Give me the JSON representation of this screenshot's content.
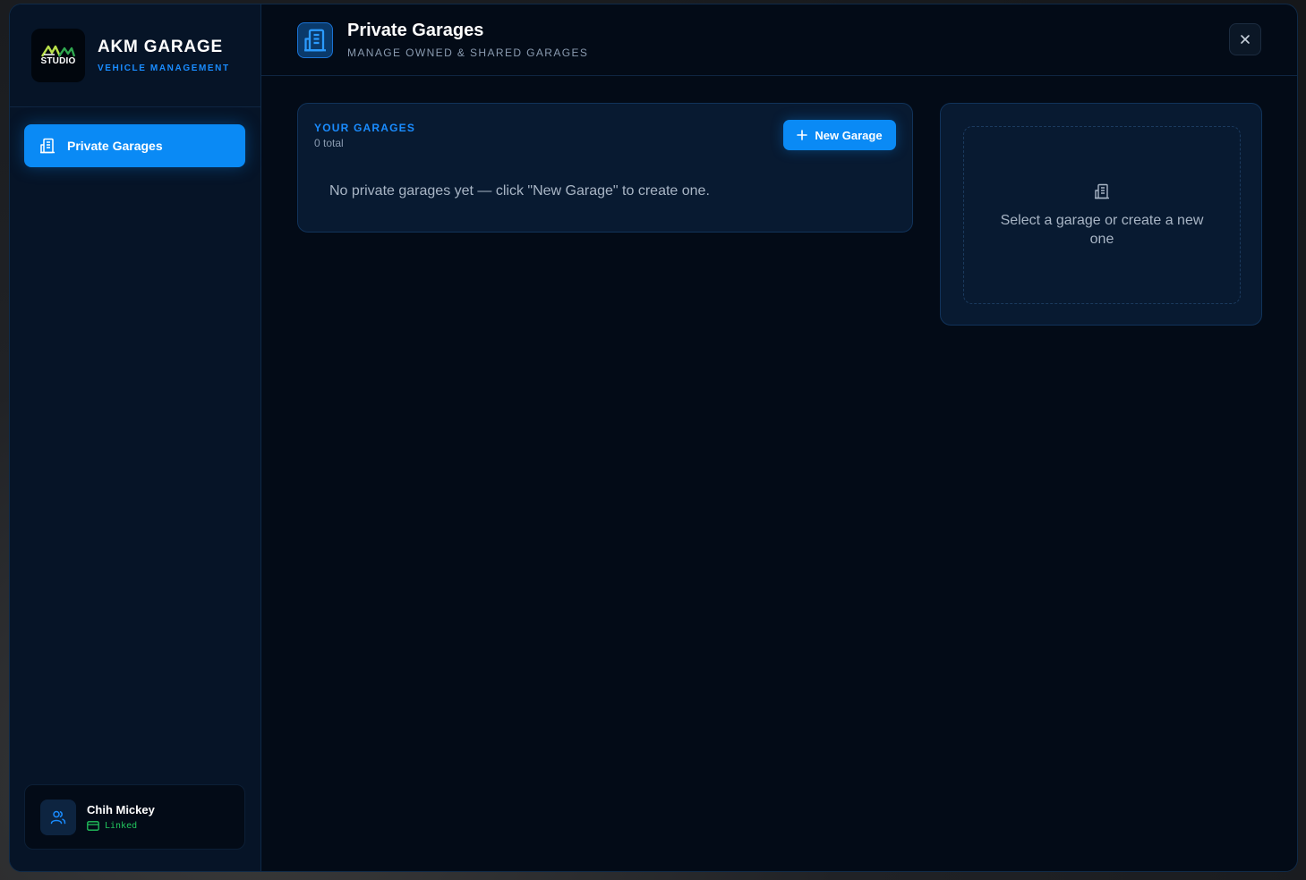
{
  "brand": {
    "logo_text": "STUDIO",
    "title": "AKM GARAGE",
    "subtitle": "VEHICLE MANAGEMENT"
  },
  "sidebar": {
    "items": [
      {
        "label": "Private Garages",
        "icon": "building-icon",
        "active": true
      }
    ]
  },
  "user": {
    "name": "Chih Mickey",
    "status": "Linked",
    "status_color": "#22c55e"
  },
  "header": {
    "title": "Private Garages",
    "subtitle": "MANAGE OWNED & SHARED GARAGES"
  },
  "garages": {
    "title": "YOUR GARAGES",
    "count": "0 total",
    "new_button": "New Garage",
    "empty_message": "No private garages yet — click \"New Garage\" to create one."
  },
  "detail": {
    "placeholder": "Select a garage or create a new one"
  },
  "colors": {
    "accent": "#0a8af5",
    "background": "#030b17",
    "panel": "#081a31"
  }
}
